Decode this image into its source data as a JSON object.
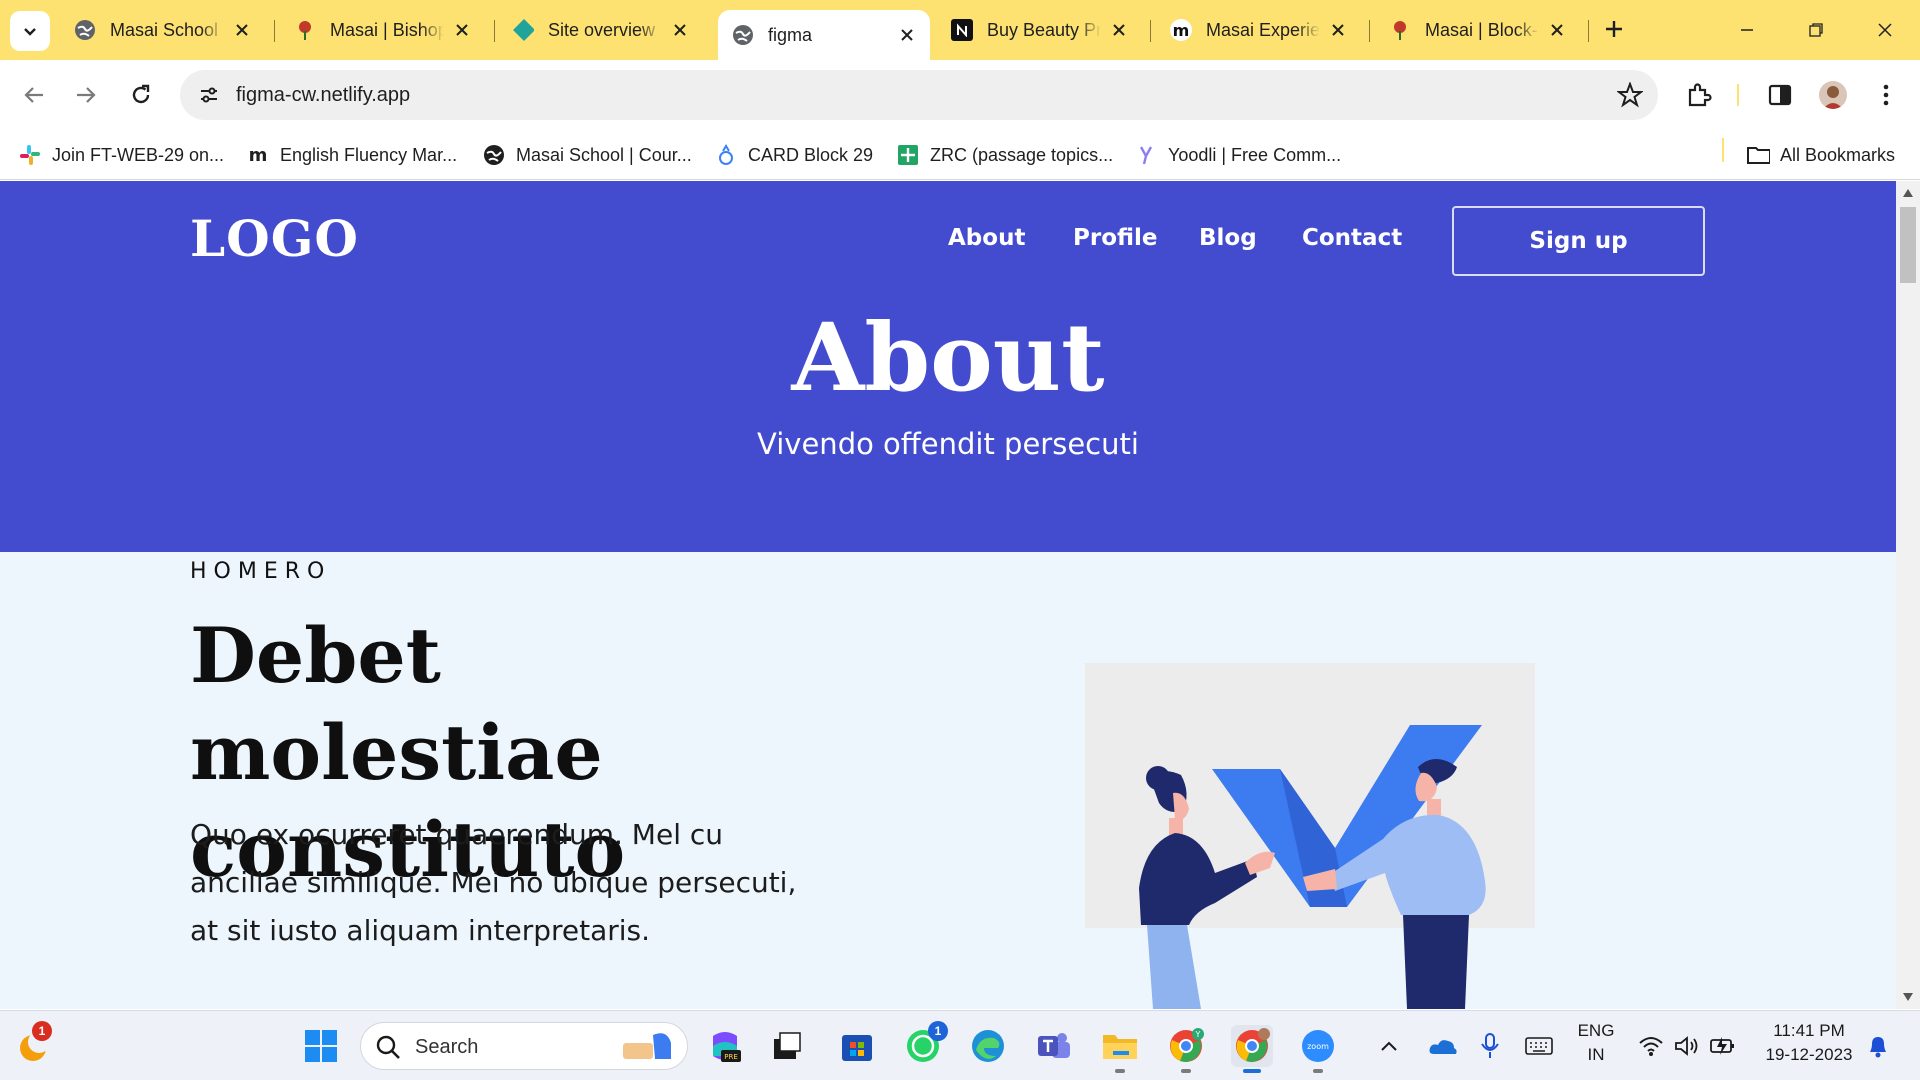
{
  "browser": {
    "tabs": [
      {
        "title": "Masai School | Courses"
      },
      {
        "title": "Masai | Bishop"
      },
      {
        "title": "Site overview | Netlify"
      },
      {
        "title": "figma"
      },
      {
        "title": "Buy Beauty Products"
      },
      {
        "title": "Masai Experience"
      },
      {
        "title": "Masai | Block-"
      }
    ],
    "active_tab_index": 3,
    "url": "figma-cw.netlify.app",
    "bookmarks": [
      {
        "label": "Join FT-WEB-29 on..."
      },
      {
        "label": "English Fluency Mar..."
      },
      {
        "label": "Masai School | Cour..."
      },
      {
        "label": "CARD Block 29"
      },
      {
        "label": "ZRC (passage topics..."
      },
      {
        "label": "Yoodli | Free Comm..."
      }
    ],
    "all_bookmarks_label": "All Bookmarks"
  },
  "page": {
    "logo": "LOGO",
    "nav": [
      "About",
      "Profile",
      "Blog",
      "Contact"
    ],
    "signup_label": "Sign up",
    "hero_title": "About",
    "hero_subtitle": "Vivendo offendit persecuti",
    "section_eyebrow": "HOMERO",
    "section_title": "Debet molestiae constituto",
    "section_body": "Quo ex ocurreret quaerendum. Mel cu ancillae similique. Mei no ubique persecuti, at sit iusto aliquam interpretaris."
  },
  "taskbar": {
    "search_placeholder": "Search",
    "weather_badge": "1",
    "whatsapp_badge": "1",
    "lang_primary": "ENG",
    "lang_secondary": "IN",
    "time": "11:41 PM",
    "date": "19-12-2023"
  },
  "colors": {
    "tabstrip": "#fde272",
    "hero": "#434ccf",
    "page_bg": "#eef6fd"
  }
}
